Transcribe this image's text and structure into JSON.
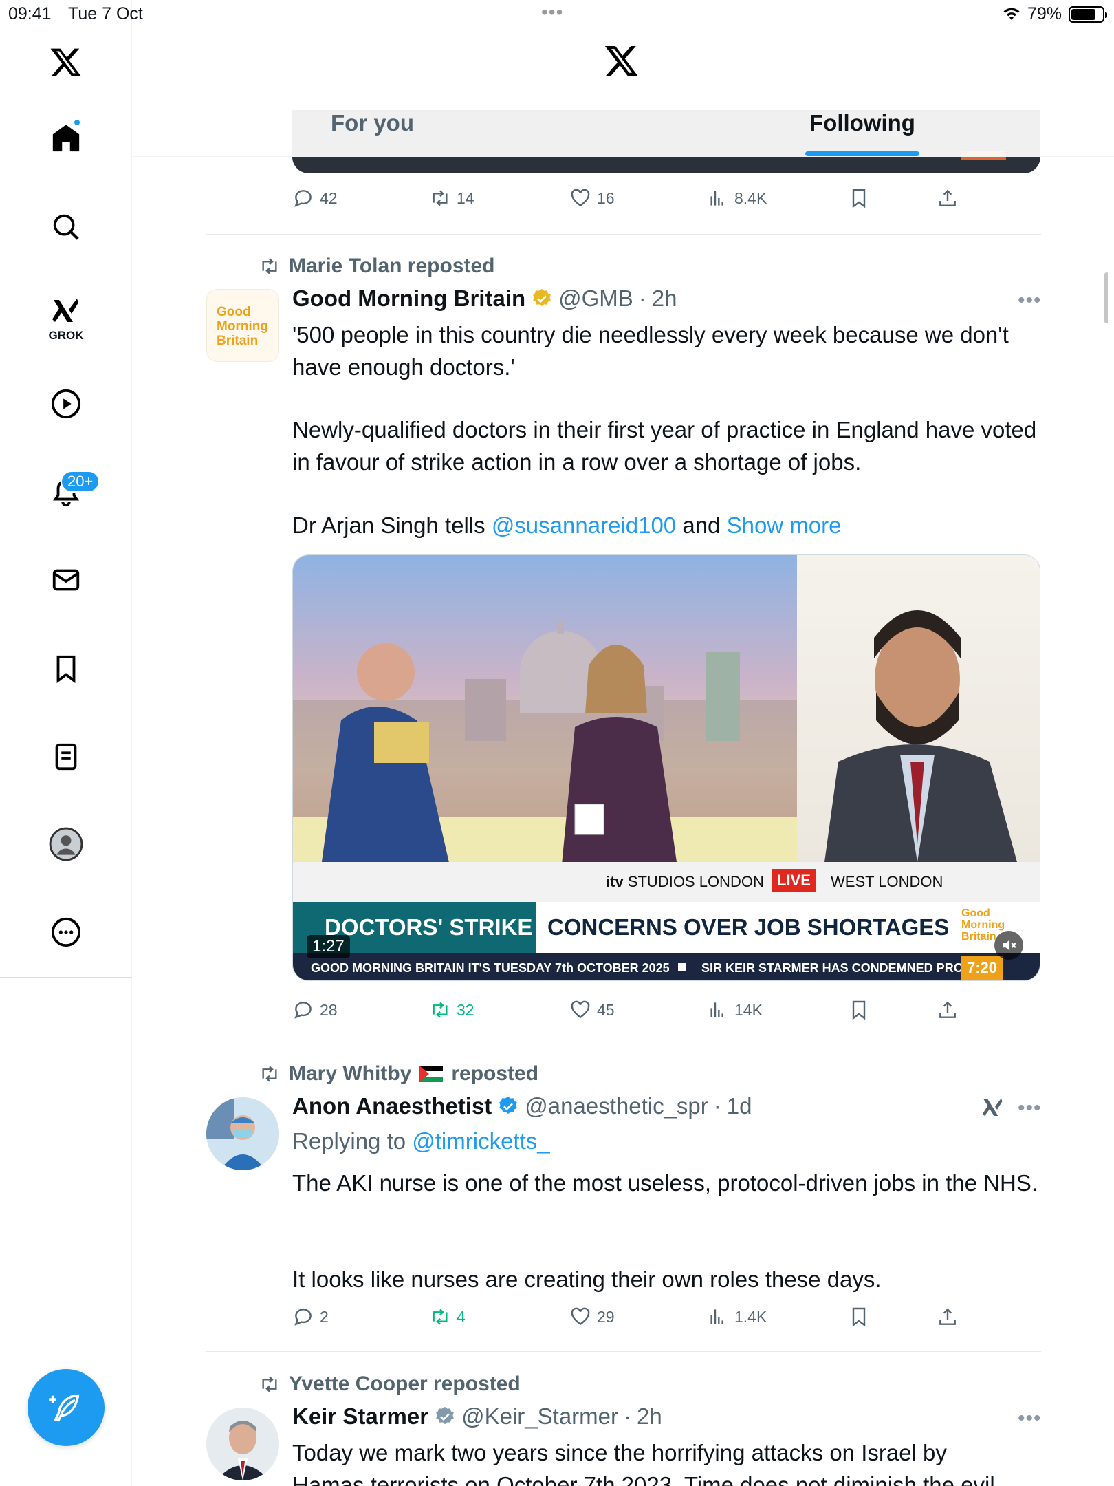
{
  "status_bar": {
    "time": "09:41",
    "date": "Tue 7 Oct",
    "battery": "79%",
    "battery_level": 0.79
  },
  "sidebar": {
    "grok_label": "GROK",
    "notifications_badge": "20+"
  },
  "header": {
    "tabs": [
      {
        "label": "For you",
        "active": false
      },
      {
        "label": "Following",
        "active": true
      }
    ]
  },
  "accent_color": "#1d9bf0",
  "feed": {
    "top_post": {
      "replies": "42",
      "reposts": "14",
      "likes": "16",
      "views": "8.4K"
    },
    "posts": [
      {
        "repost_by": "Marie Tolan reposted",
        "name": "Good Morning Britain",
        "handle": "@GMB",
        "time": "2h",
        "avatar_text": [
          "Good",
          "Morning",
          "Britain"
        ],
        "text1": "'500 people in this country die needlessly every week because we don't have enough doctors.'",
        "text2": "Newly-qualified doctors in their first year of practice in England have voted in favour of strike action in a row over a shortage of jobs.",
        "text3_prefix": "Dr Arjan Singh tells ",
        "mention": "@susannareid100",
        "text3_mid": " and ",
        "show_more": "Show more",
        "video": {
          "studio": "STUDIOS LONDON",
          "itv": "itv",
          "live": "LIVE",
          "location": "WEST LONDON",
          "strap": "DOCTORS' STRIKE",
          "headline": "CONCERNS OVER JOB SHORTAGES",
          "gmb_logo": [
            "Good",
            "Morning",
            "Britain"
          ],
          "ticker1": "GOOD MORNING BRITAIN IT'S TUESDAY 7th OCTOBER 2025",
          "ticker2": "SIR KEIR STARMER HAS CONDEMNED PRO",
          "clock": "7:20",
          "duration": "1:27"
        },
        "replies": "28",
        "reposts": "32",
        "likes": "45",
        "views": "14K"
      },
      {
        "repost_by_name": "Mary Whitby",
        "repost_suffix": "reposted",
        "name": "Anon Anaesthetist",
        "handle": "@anaesthetic_spr",
        "time": "1d",
        "replying_to_label": "Replying to ",
        "replying_to": "@timricketts_",
        "text1": "The AKI nurse is one of the most useless, protocol-driven jobs in the NHS.",
        "text2": "It looks like nurses are creating their own roles these days.",
        "replies": "2",
        "reposts": "4",
        "likes": "29",
        "views": "1.4K"
      },
      {
        "repost_by": "Yvette Cooper reposted",
        "name": "Keir Starmer",
        "handle": "@Keir_Starmer",
        "time": "2h",
        "text1": "Today we mark two years since the horrifying attacks on Israel by",
        "text2": "Hamas terrorists on October 7th 2023. Time does not diminish the evil"
      }
    ]
  }
}
